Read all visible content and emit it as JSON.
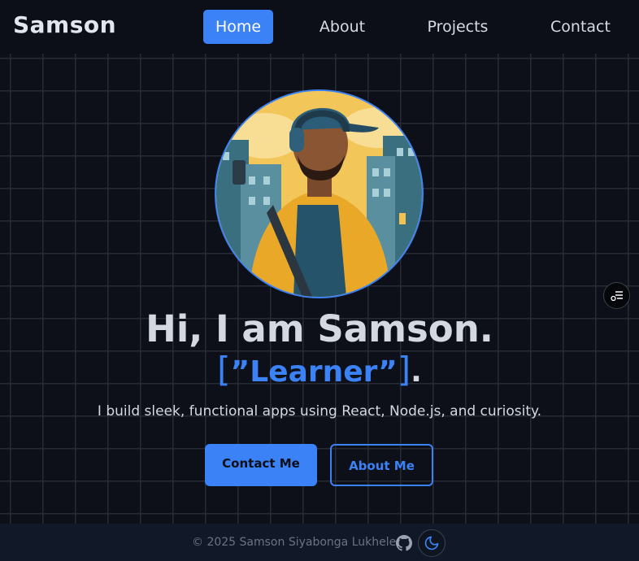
{
  "header": {
    "brand": "Samson",
    "nav": [
      {
        "label": "Home",
        "active": true
      },
      {
        "label": "About",
        "active": false
      },
      {
        "label": "Projects",
        "active": false
      },
      {
        "label": "Contact",
        "active": false
      }
    ]
  },
  "hero": {
    "greeting": "Hi, I am Samson.",
    "role_open_bracket": "[",
    "role_open_quote": "”",
    "role": "Learner",
    "role_close_quote": "”",
    "role_close_bracket": "]",
    "role_period": ".",
    "tagline": "I build sleek, functional apps using React, Node.js, and curiosity.",
    "primary_button": "Contact Me",
    "secondary_button": "About Me"
  },
  "footer": {
    "copyright": "© 2025 Samson Siyabonga Lukhele"
  },
  "icons": {
    "github": "github-icon",
    "theme": "moon-icon",
    "side_menu": "menu-settings-icon"
  },
  "colors": {
    "accent": "#3b82f6",
    "background": "#0d1018",
    "grid_line": "#262b36",
    "footer_bg": "#111827"
  }
}
